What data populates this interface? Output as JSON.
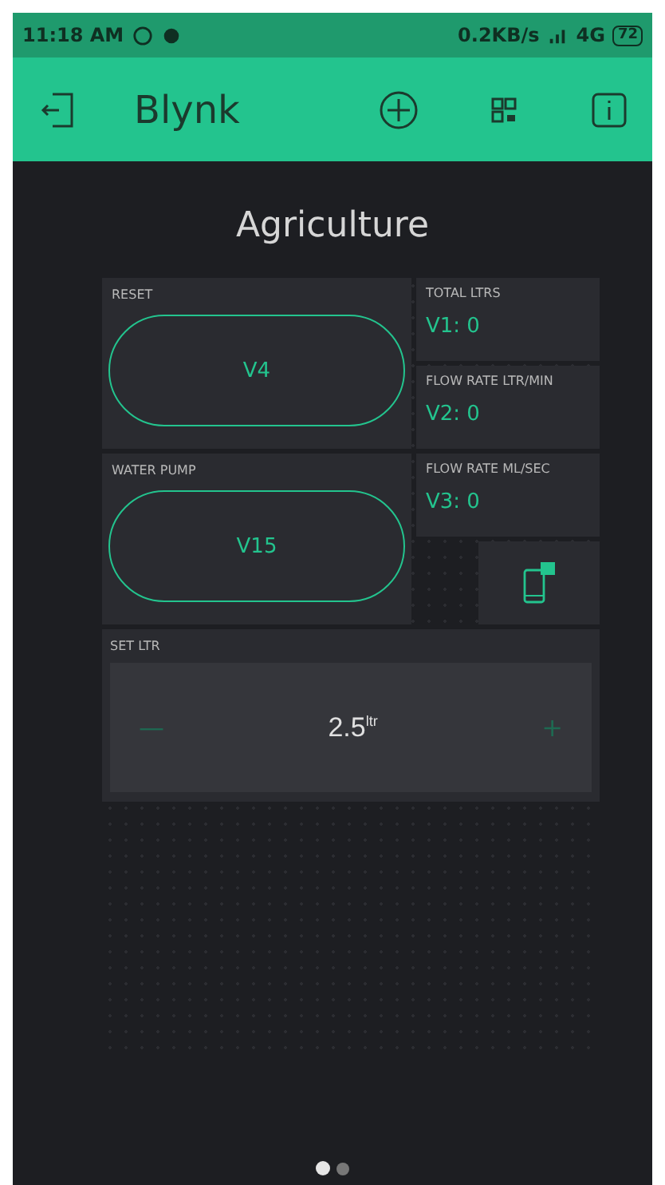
{
  "status_bar": {
    "time": "11:18 AM",
    "speed": "0.2KB/s",
    "network": "4G",
    "battery": "72"
  },
  "app_bar": {
    "title": "Blynk"
  },
  "dashboard": {
    "title": "Agriculture",
    "widgets": [
      {
        "kind": "button",
        "label": "RESET",
        "value": "V4"
      },
      {
        "kind": "display",
        "label": "TOTAL  LTRS",
        "value": "V1: 0"
      },
      {
        "kind": "display",
        "label": "FLOW RATE LTR/MIN",
        "value": "V2: 0"
      },
      {
        "kind": "button",
        "label": "WATER PUMP",
        "value": "V15"
      },
      {
        "kind": "display",
        "label": "FLOW RATE ML/SEC",
        "value": "V3: 0"
      },
      {
        "kind": "notification"
      },
      {
        "kind": "stepper",
        "label": "SET LTR",
        "value": "2.5$^{ltr}$",
        "minus": "—",
        "plus": "+"
      }
    ]
  },
  "pages": [
    {
      "selected": true
    },
    {
      "selected": false
    }
  ]
}
